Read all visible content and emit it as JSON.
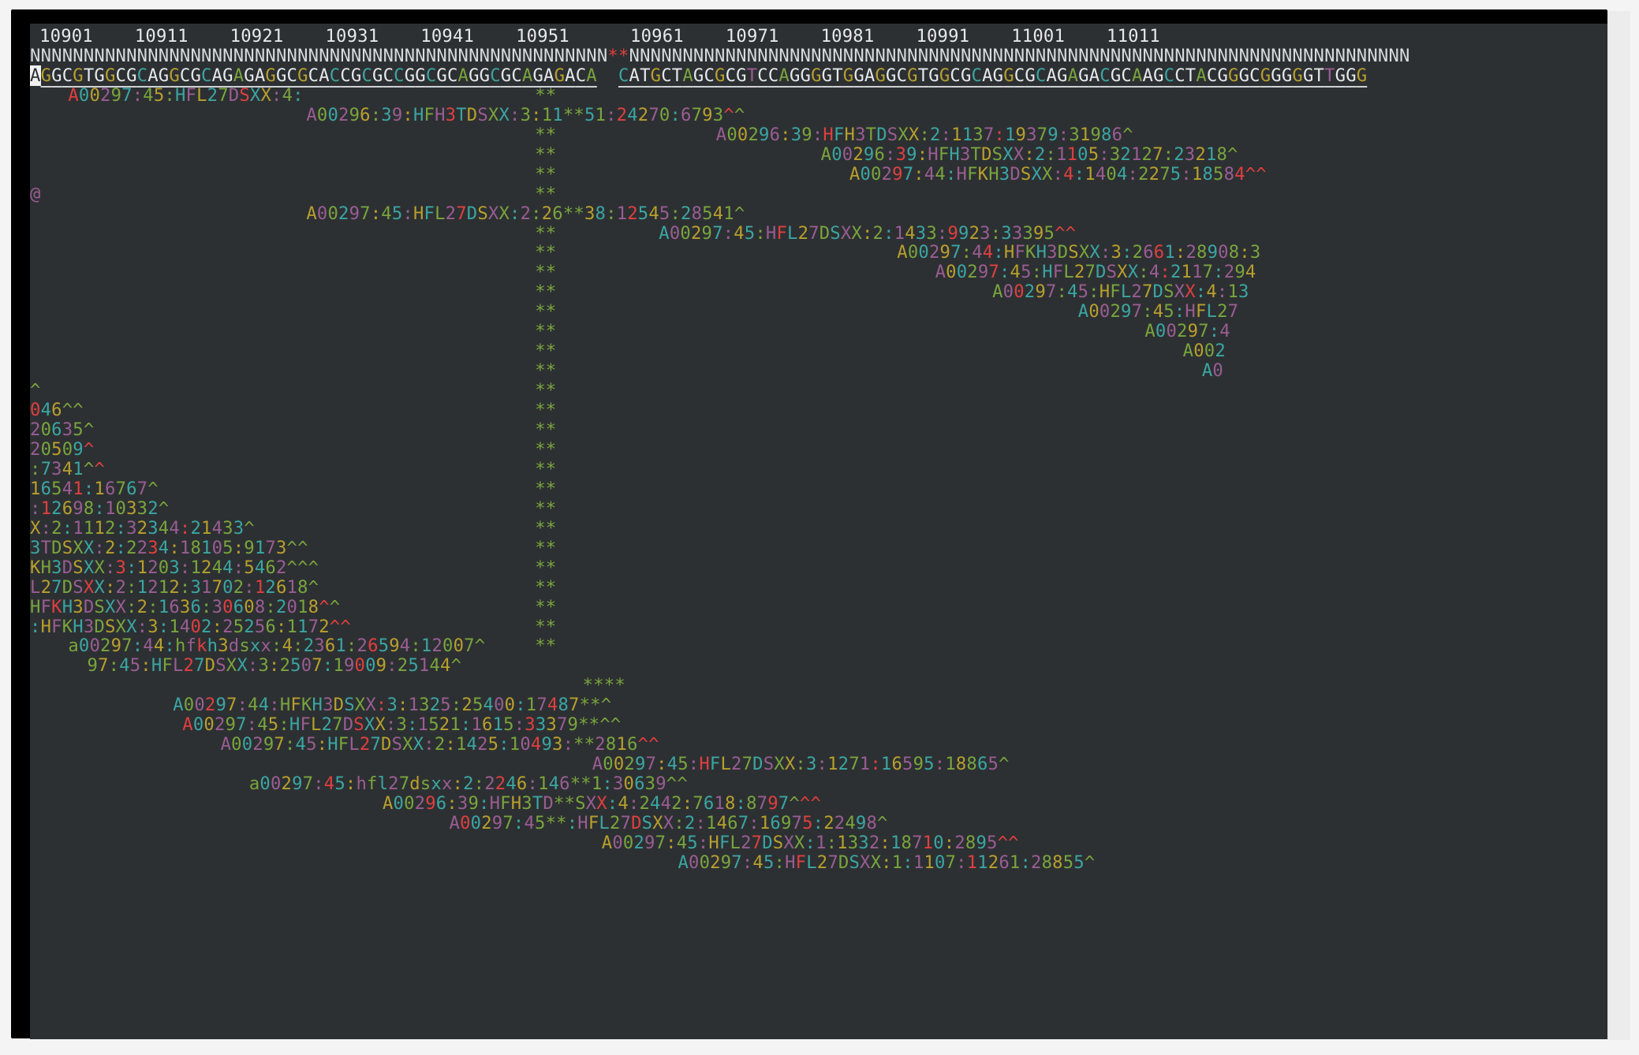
{
  "terminal": {
    "ruler": [
      {
        "col": 1,
        "text": "10901"
      },
      {
        "col": 11,
        "text": "10911"
      },
      {
        "col": 21,
        "text": "10921"
      },
      {
        "col": 31,
        "text": "10931"
      },
      {
        "col": 41,
        "text": "10941"
      },
      {
        "col": 51,
        "text": "10951"
      },
      {
        "col": 63,
        "text": "10961"
      },
      {
        "col": 73,
        "text": "10971"
      },
      {
        "col": 83,
        "text": "10981"
      },
      {
        "col": 93,
        "text": "10991"
      },
      {
        "col": 103,
        "text": "11001"
      },
      {
        "col": 113,
        "text": "11011"
      }
    ],
    "reference_line": "NNNNNNNNNNNNNNNNNNNNNNNNNNNNNNNNNNNNNNNNNNNNNNNNNNNNNN**NNNNNNNNNNNNNNNNNNNNNNNNNNNNNNNNNNNNNNNNNNNNNNNNNNNNNNNNNNNNNNNNNNNNNNNNN",
    "consensus_line": "AGGCGTGGCGCAGGCGCAGAGAGGCGCACCGCGCCGGCGCAGGCGCAGAGACA  CATGCTAGCGCGTCCAGGGGTGGAGGCGTGGCGCAGGCGCAGAGACGCAAGCCTACGGGCGGGGGTTGGG",
    "reads": [
      {
        "col": 4,
        "text": "A00297:45:HFL27DSXX:4:"
      },
      {
        "col": 29,
        "text": "A00296:39:HFH3TDSXX:3:11**51:24270:6793^^"
      },
      {
        "col": 72,
        "text": "A00296:39:HFH3TDSXX:2:1137:19379:31986^"
      },
      {
        "col": 83,
        "text": "A00296:39:HFH3TDSXX:2:1105:32127:23218^"
      },
      {
        "col": 86,
        "text": "A00297:44:HFKH3DSXX:4:1404:2275:18584^^"
      },
      {
        "col": 0,
        "text": "@"
      },
      {
        "col": 29,
        "text": "A00297:45:HFL27DSXX:2:26**38:12545:28541^"
      },
      {
        "col": 66,
        "text": "A00297:45:HFL27DSXX:2:1433:9923:33395^^"
      },
      {
        "col": 91,
        "text": "A00297:44:HFKH3DSXX:3:2661:28908:3"
      },
      {
        "col": 95,
        "text": "A00297:45:HFL27DSXX:4:2117:294"
      },
      {
        "col": 101,
        "text": "A00297:45:HFL27DSXX:4:13"
      },
      {
        "col": 110,
        "text": "A00297:45:HFL27"
      },
      {
        "col": 117,
        "text": "A00297:4"
      },
      {
        "col": 121,
        "text": "A002"
      },
      {
        "col": 123,
        "text": "A0"
      },
      {
        "col": 0,
        "text": "^"
      },
      {
        "col": 0,
        "text": "046^^"
      },
      {
        "col": 0,
        "text": "20635^"
      },
      {
        "col": 0,
        "text": "20509^"
      },
      {
        "col": 0,
        "text": ":7341^^"
      },
      {
        "col": 0,
        "text": "16541:16767^"
      },
      {
        "col": 0,
        "text": ":12698:10332^"
      },
      {
        "col": 0,
        "text": "X:2:1112:32344:21433^"
      },
      {
        "col": 0,
        "text": "3TDSXX:2:2234:18105:9173^^"
      },
      {
        "col": 0,
        "text": "KH3DSXX:3:1203:1244:5462^^^"
      },
      {
        "col": 0,
        "text": "L27DSXX:2:1212:31702:12618^"
      },
      {
        "col": 0,
        "text": "HFKH3DSXX:2:1636:30608:2018^^"
      },
      {
        "col": 0,
        "text": ":HFKH3DSXX:3:1402:25256:1172^^"
      },
      {
        "col": 4,
        "text": "a00297:44:hfkh3dsxx:4:2361:26594:12007^"
      },
      {
        "col": 6,
        "text": "97:45:HFL27DSXX:3:2507:19009:25144^"
      },
      {
        "col": 58,
        "text": "****"
      },
      {
        "col": 15,
        "text": "A00297:44:HFKH3DSXX:3:1325:25400:17487**^"
      },
      {
        "col": 16,
        "text": "A00297:45:HFL27DSXX:3:1521:1615:33379**^^"
      },
      {
        "col": 20,
        "text": "A00297:45:HFL27DSXX:2:1425:10493:**2816^^"
      },
      {
        "col": 59,
        "text": "A00297:45:HFL27DSXX:3:1271:16595:18865^"
      },
      {
        "col": 23,
        "text": "a00297:45:hfl27dsxx:2:2246:146**1:30639^^"
      },
      {
        "col": 37,
        "text": "A00296:39:HFH3TD**SXX:4:2442:7618:8797^^^"
      },
      {
        "col": 44,
        "text": "A00297:45**:HFL27DSXX:2:1467:16975:22498^"
      },
      {
        "col": 60,
        "text": "A00297:45:HFL27DSXX:1:1332:18710:2895^^"
      },
      {
        "col": 68,
        "text": "A00297:45:HFL27DSXX:1:1107:11261:28855^"
      }
    ],
    "insertion_marker": "**",
    "colors": {
      "background": "#2d3033",
      "base_A": "#79a53c",
      "base_C": "#3aa6a2",
      "base_G": "#b8a02c",
      "base_T": "#9a5d92",
      "mismatch": "#e03f3f",
      "reference": "#d8dbde"
    }
  }
}
